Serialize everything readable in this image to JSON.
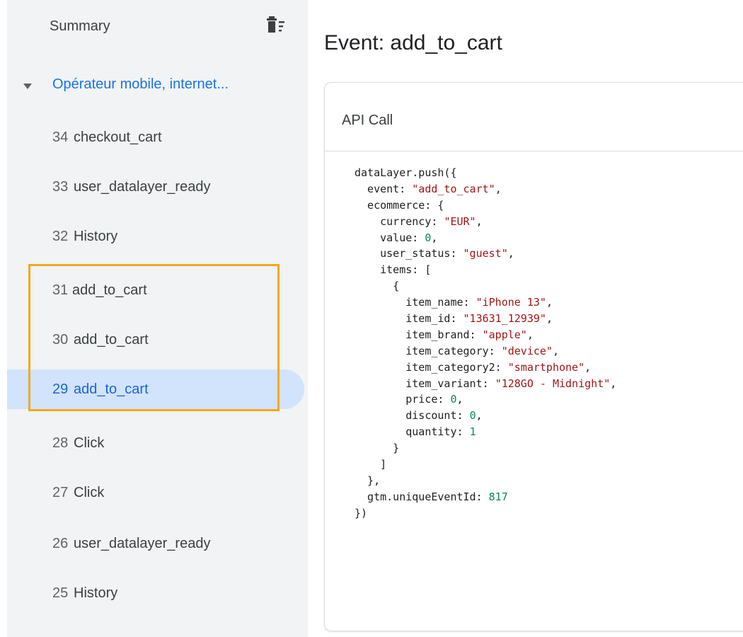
{
  "sidebar": {
    "summary_label": "Summary",
    "clear_icon": "delete-sweep-icon",
    "container": {
      "label": "Opérateur mobile, internet...",
      "caret_icon": "caret-down-icon"
    },
    "events": [
      {
        "number": "34",
        "name": "checkout_cart",
        "selected": false
      },
      {
        "number": "33",
        "name": "user_datalayer_ready",
        "selected": false
      },
      {
        "number": "32",
        "name": "History",
        "selected": false
      },
      {
        "number": "31",
        "name": "add_to_cart",
        "selected": false
      },
      {
        "number": "30",
        "name": "add_to_cart",
        "selected": false
      },
      {
        "number": "29",
        "name": "add_to_cart",
        "selected": true
      },
      {
        "number": "28",
        "name": "Click",
        "selected": false
      },
      {
        "number": "27",
        "name": "Click",
        "selected": false
      },
      {
        "number": "26",
        "name": "user_datalayer_ready",
        "selected": false
      },
      {
        "number": "25",
        "name": "History",
        "selected": false
      }
    ]
  },
  "main": {
    "title": "Event: add_to_cart",
    "card_title": "API Call",
    "code_lines": [
      [
        {
          "t": "dataLayer.push({",
          "c": "key"
        }
      ],
      [
        {
          "t": "  event: ",
          "c": "key"
        },
        {
          "t": "\"add_to_cart\"",
          "c": "str"
        },
        {
          "t": ",",
          "c": "key"
        }
      ],
      [
        {
          "t": "  ecommerce: {",
          "c": "key"
        }
      ],
      [
        {
          "t": "    currency: ",
          "c": "key"
        },
        {
          "t": "\"EUR\"",
          "c": "str"
        },
        {
          "t": ",",
          "c": "key"
        }
      ],
      [
        {
          "t": "    value: ",
          "c": "key"
        },
        {
          "t": "0",
          "c": "num-lit"
        },
        {
          "t": ",",
          "c": "key"
        }
      ],
      [
        {
          "t": "    user_status: ",
          "c": "key"
        },
        {
          "t": "\"guest\"",
          "c": "str"
        },
        {
          "t": ",",
          "c": "key"
        }
      ],
      [
        {
          "t": "    items: [",
          "c": "key"
        }
      ],
      [
        {
          "t": "      {",
          "c": "key"
        }
      ],
      [
        {
          "t": "        item_name: ",
          "c": "key"
        },
        {
          "t": "\"iPhone 13\"",
          "c": "str"
        },
        {
          "t": ",",
          "c": "key"
        }
      ],
      [
        {
          "t": "        item_id: ",
          "c": "key"
        },
        {
          "t": "\"13631_12939\"",
          "c": "str"
        },
        {
          "t": ",",
          "c": "key"
        }
      ],
      [
        {
          "t": "        item_brand: ",
          "c": "key"
        },
        {
          "t": "\"apple\"",
          "c": "str"
        },
        {
          "t": ",",
          "c": "key"
        }
      ],
      [
        {
          "t": "        item_category: ",
          "c": "key"
        },
        {
          "t": "\"device\"",
          "c": "str"
        },
        {
          "t": ",",
          "c": "key"
        }
      ],
      [
        {
          "t": "        item_category2: ",
          "c": "key"
        },
        {
          "t": "\"smartphone\"",
          "c": "str"
        },
        {
          "t": ",",
          "c": "key"
        }
      ],
      [
        {
          "t": "        item_variant: ",
          "c": "key"
        },
        {
          "t": "\"128GO - Midnight\"",
          "c": "str"
        },
        {
          "t": ",",
          "c": "key"
        }
      ],
      [
        {
          "t": "        price: ",
          "c": "key"
        },
        {
          "t": "0",
          "c": "num-lit"
        },
        {
          "t": ",",
          "c": "key"
        }
      ],
      [
        {
          "t": "        discount: ",
          "c": "key"
        },
        {
          "t": "0",
          "c": "num-lit"
        },
        {
          "t": ",",
          "c": "key"
        }
      ],
      [
        {
          "t": "        quantity: ",
          "c": "key"
        },
        {
          "t": "1",
          "c": "num-lit"
        }
      ],
      [
        {
          "t": "      }",
          "c": "key"
        }
      ],
      [
        {
          "t": "    ]",
          "c": "key"
        }
      ],
      [
        {
          "t": "  },",
          "c": "key"
        }
      ],
      [
        {
          "t": "  gtm.uniqueEventId: ",
          "c": "key"
        },
        {
          "t": "817",
          "c": "num-lit"
        }
      ],
      [
        {
          "t": "})",
          "c": "key"
        }
      ]
    ]
  },
  "colors": {
    "sidebar_bg": "#f1f3f4",
    "accent_blue": "#1a73e8",
    "selected_bg": "#d2e3fc",
    "highlight_border": "#f3a81b",
    "string_color": "#a31515",
    "number_color": "#098658"
  }
}
